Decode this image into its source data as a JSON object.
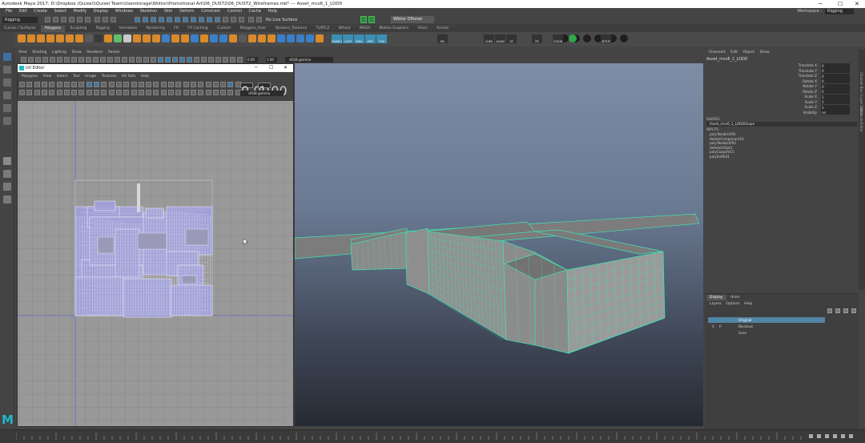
{
  "window": {
    "title": "Autodesk Maya 2017: D:\\Dropbox (Quixel)\\Quixel Team\\Userstorage\\Wiktor\\Promotional Art\\06_DUST2\\06_DUST2_Wireframes.mb*   ---   Asset_mcs6_1_LOD0",
    "controls": [
      "─",
      "☐",
      "✕"
    ]
  },
  "menubar": {
    "items": [
      "File",
      "Edit",
      "Create",
      "Select",
      "Modify",
      "Display",
      "Windows",
      "Skeleton",
      "Skin",
      "Deform",
      "Constrain",
      "Control",
      "Cache",
      "Help"
    ]
  },
  "workspace": {
    "label": "Workspace :",
    "value": "Rigging"
  },
  "statusline": {
    "mode": "Rigging",
    "no_live": "No Live Surface",
    "user": "Wiktor Ofinner"
  },
  "shelf": {
    "tabs": [
      "Curves / Surfaces",
      "Polygons",
      "Sculpting",
      "Rigging",
      "Animation",
      "Rendering",
      "FX",
      "FX Caching",
      "Custom",
      "Polygons_User",
      "Shaders_Textures",
      "TURTLE",
      "Bifrost",
      "MASH",
      "Motion Graphics",
      "XGen",
      "Arnold"
    ],
    "active_tab": "Polygons",
    "text_buttons": [
      "UNWELD",
      "LOOP",
      "RING",
      "PIPE",
      "TUB",
      "SEL",
      "CURV",
      "ALIGN",
      "OF",
      "FR",
      "COLOR",
      "SETUP"
    ]
  },
  "viewport": {
    "menu": [
      "View",
      "Shading",
      "Lighting",
      "Show",
      "Renderer",
      "Panels"
    ],
    "near": "0.00",
    "far": "1.00",
    "color_space": "sRGB gamma",
    "background_colors": {
      "top": "#7d8da6",
      "bottom": "#262a32"
    },
    "wireframe_color": "#3fe3b5"
  },
  "uv_editor": {
    "title": "UV Editor",
    "controls": [
      "─",
      "☐",
      "✕"
    ],
    "menu": [
      "Polygons",
      "View",
      "Select",
      "Tool",
      "Image",
      "Textures",
      "UV Sets",
      "Help"
    ],
    "num1": "0.00",
    "num2": "1.00",
    "color_space": "sRGB gamma",
    "background": "#999999",
    "shell_color": "#a0a0d6"
  },
  "channel_box": {
    "tabs": [
      "Channels",
      "Edit",
      "Object",
      "Show"
    ],
    "object_name": "Asset_mcs6_1_LOD0",
    "attributes": [
      {
        "name": "Translate X",
        "value": "0"
      },
      {
        "name": "Translate Y",
        "value": "0"
      },
      {
        "name": "Translate Z",
        "value": "0"
      },
      {
        "name": "Rotate X",
        "value": "0"
      },
      {
        "name": "Rotate Y",
        "value": "0"
      },
      {
        "name": "Rotate Z",
        "value": "0"
      },
      {
        "name": "Scale X",
        "value": "1"
      },
      {
        "name": "Scale Y",
        "value": "1"
      },
      {
        "name": "Scale Z",
        "value": "1"
      },
      {
        "name": "Visibility",
        "value": "on"
      }
    ],
    "shapes_label": "SHAPES",
    "shape_name": "Asset_mcs6_1_LOD0Shape",
    "inputs_label": "INPUTS",
    "inputs": [
      "polyTweakUV91",
      "deleteComponent16",
      "polyTweakUV62",
      "deleteUVSet1",
      "polyCopyUV15",
      "polySoftEd1"
    ],
    "side_tabs": [
      "Channel Box / Layer Editor",
      "Attribute Editor"
    ]
  },
  "layer_editor": {
    "tabs": [
      "Display",
      "Anim"
    ],
    "active_tab": "Display",
    "menu": [
      "Layers",
      "Options",
      "Help"
    ],
    "layers": [
      {
        "v": "",
        "p": "",
        "name": "Original",
        "selected": true
      },
      {
        "v": "V",
        "p": "P",
        "name": "Blockout",
        "selected": false
      },
      {
        "v": "",
        "p": "",
        "name": "Scan",
        "selected": false
      }
    ]
  }
}
